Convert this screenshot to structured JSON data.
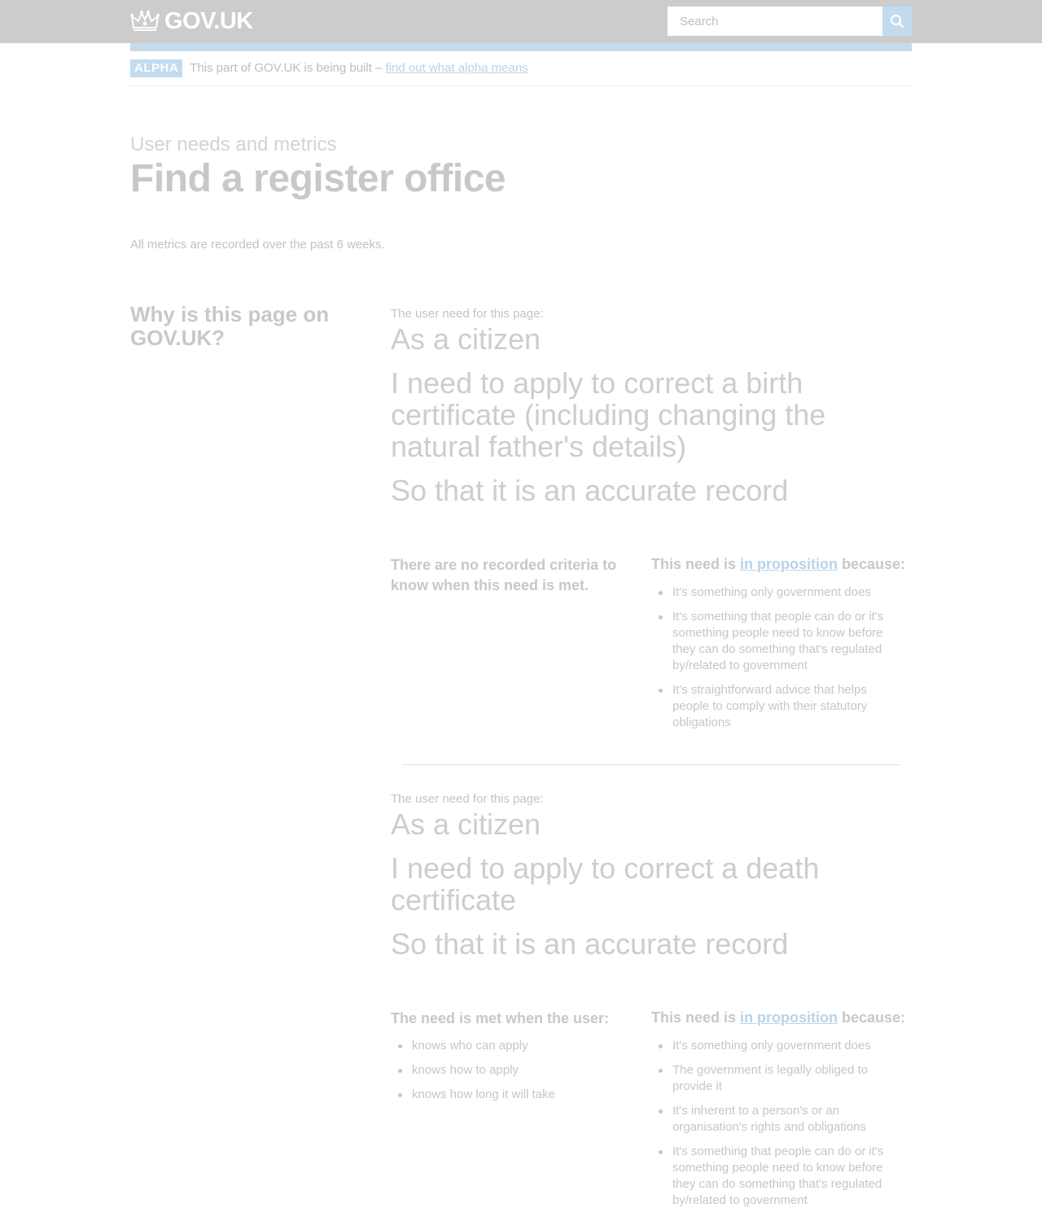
{
  "header": {
    "logo_text": "GOV.UK",
    "search_placeholder": "Search",
    "accent_color": "#c5dbec"
  },
  "phase_banner": {
    "tag": "ALPHA",
    "text": "This part of GOV.UK is being built – ",
    "link": "find out what alpha means"
  },
  "page": {
    "kicker": "User needs and metrics",
    "title": "Find a register office",
    "lede": "All metrics are recorded over the past 6 weeks."
  },
  "section": {
    "heading": "Why is this page on GOV.UK?"
  },
  "needs": [
    {
      "intro": "The user need for this page:",
      "role": "As a citizen",
      "goal": "I need to apply to correct a birth certificate (including changing the natural father's details)",
      "benefit": "So that it is an accurate record",
      "criteria_heading": "There are no recorded criteria to know when this need is met.",
      "criteria": [],
      "proposition_prefix": "This need is ",
      "proposition_link": "in proposition",
      "proposition_suffix": " because:",
      "reasons": [
        "It's something only government does",
        "It's something that people can do or it's something people need to know before they can do something that's regulated by/related to government",
        "It's straightforward advice that helps people to comply with their statutory obligations"
      ]
    },
    {
      "intro": "The user need for this page:",
      "role": "As a citizen",
      "goal": "I need to apply to correct a death certificate",
      "benefit": "So that it is an accurate record",
      "criteria_heading": "The need is met when the user:",
      "criteria": [
        "knows who can apply",
        "knows how to apply",
        "knows how long it will take"
      ],
      "proposition_prefix": "This need is ",
      "proposition_link": "in proposition",
      "proposition_suffix": " because:",
      "reasons": [
        "It's something only government does",
        "The government is legally obliged to provide it",
        "It's inherent to a person's or an organisation's rights and obligations",
        "It's something that people can do or it's something people need to know before they can do something that's regulated by/related to government"
      ]
    }
  ]
}
